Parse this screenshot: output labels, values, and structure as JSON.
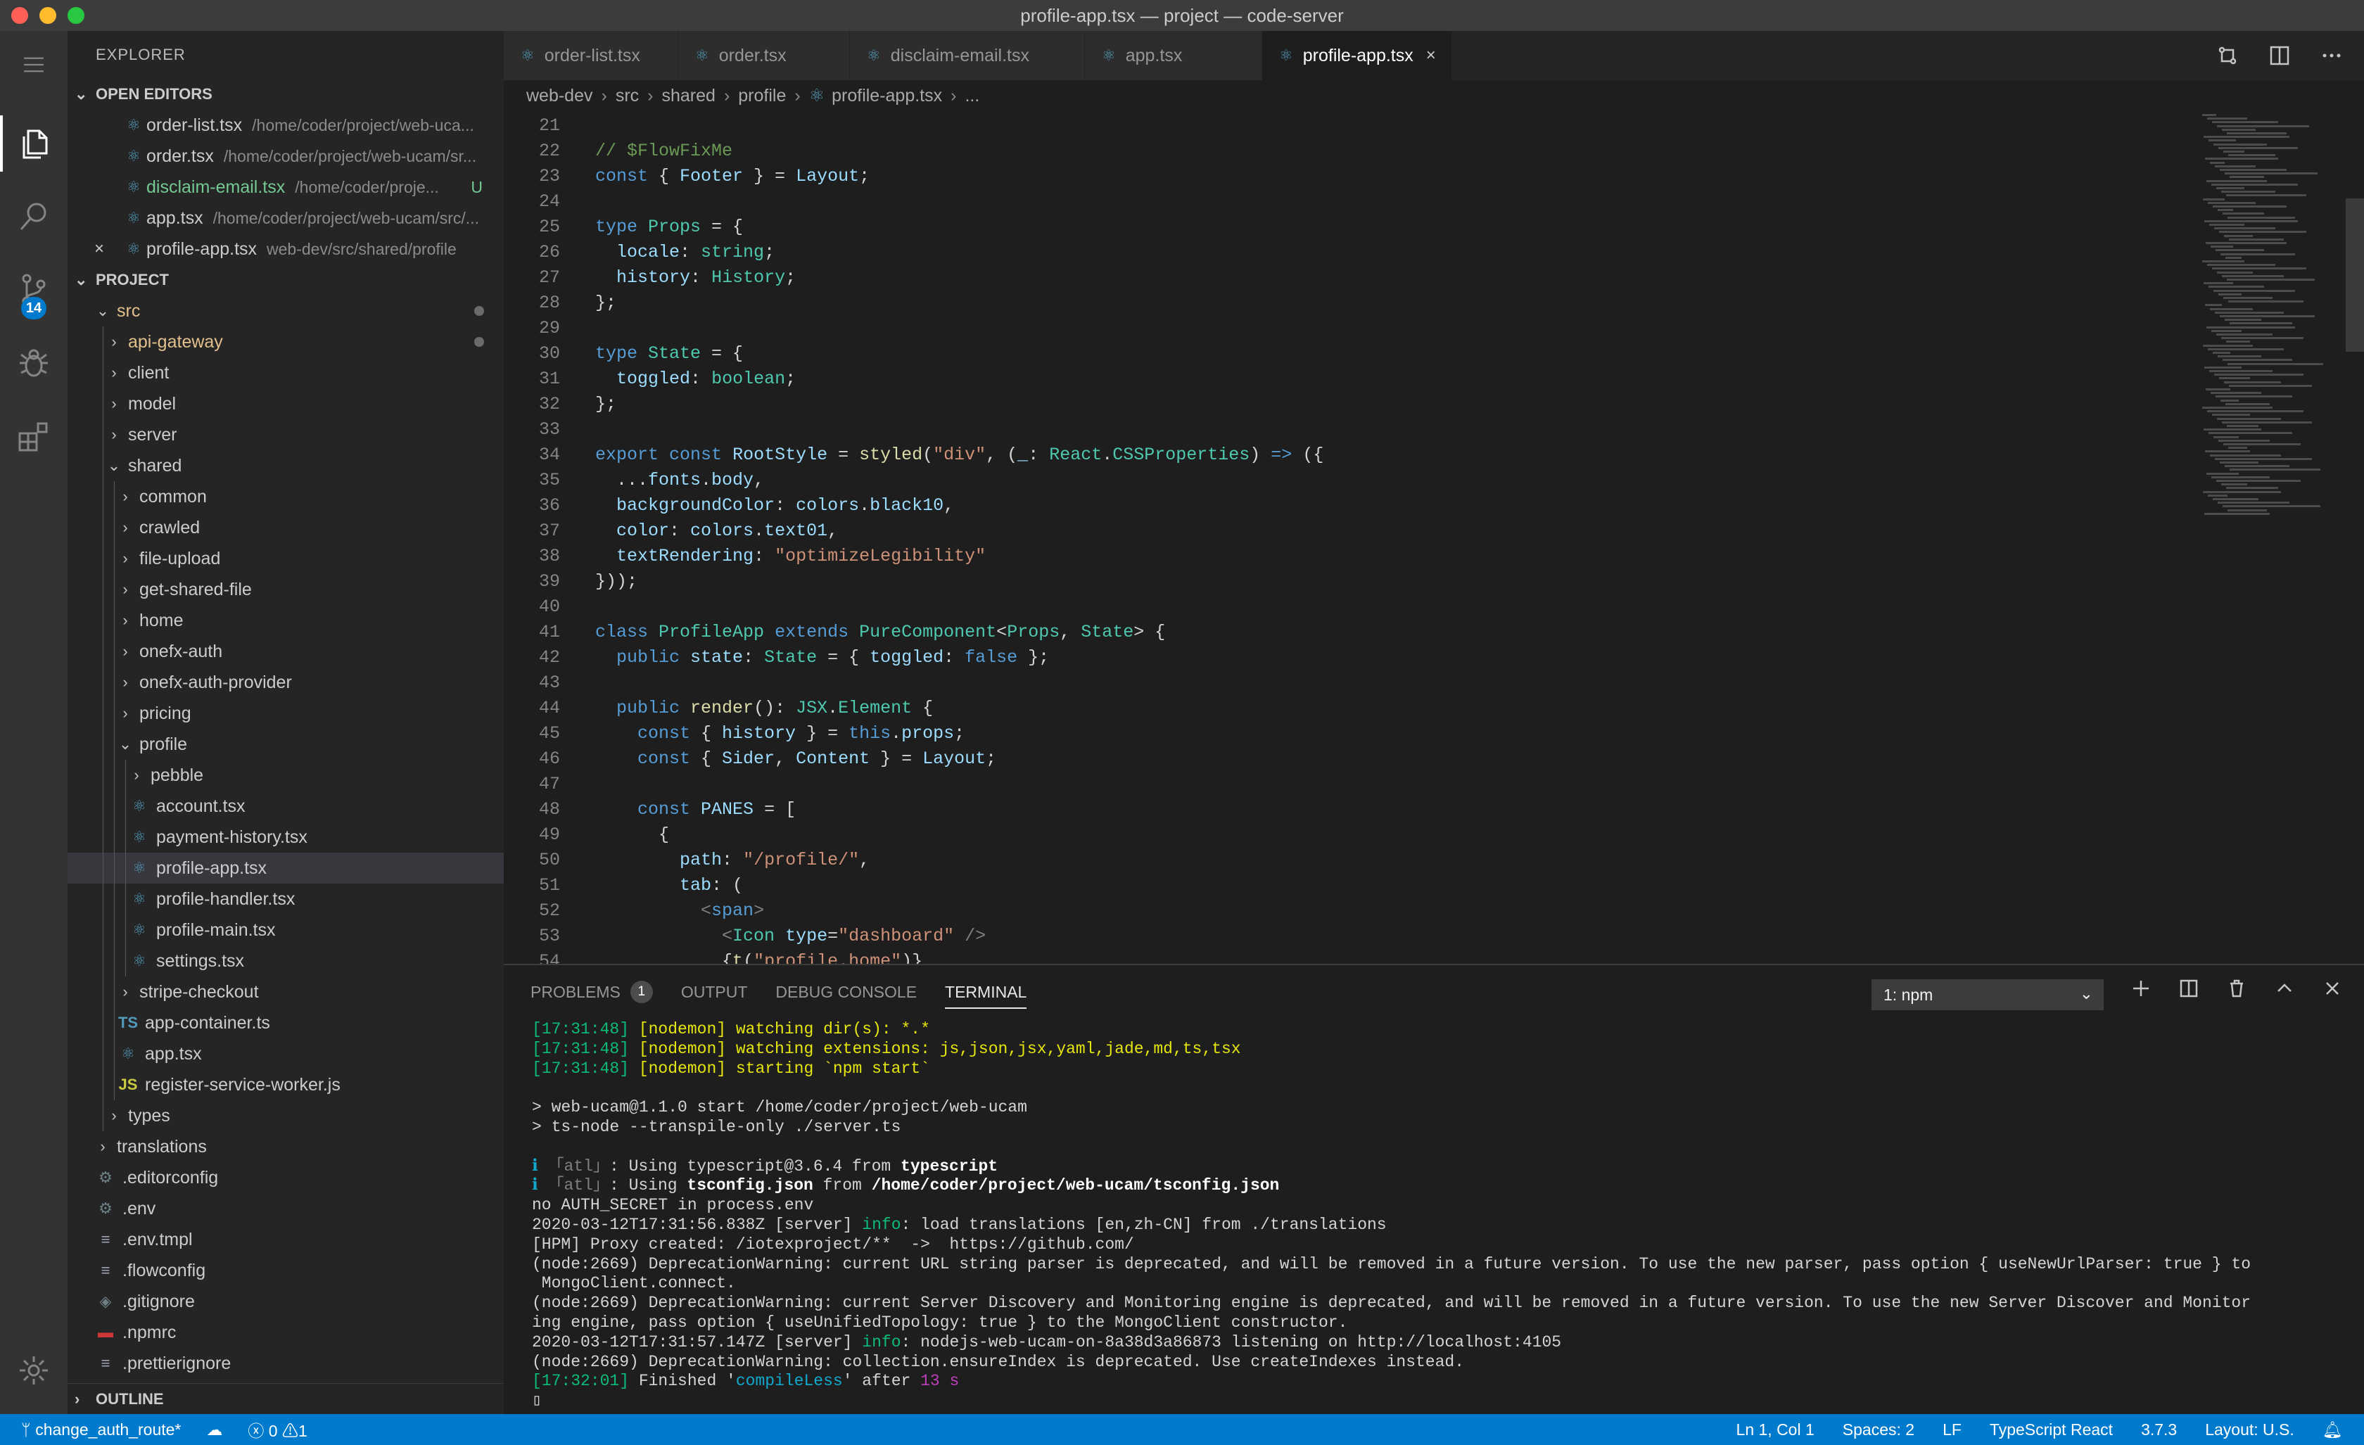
{
  "window": {
    "title": "profile-app.tsx — project — code-server"
  },
  "activity": {
    "scm_badge": "14"
  },
  "explorer": {
    "title": "EXPLORER",
    "open_editors_label": "OPEN EDITORS",
    "open_editors": [
      {
        "name": "order-list.tsx",
        "path": "/home/coder/project/web-uca...",
        "git": ""
      },
      {
        "name": "order.tsx",
        "path": "/home/coder/project/web-ucam/sr...",
        "git": ""
      },
      {
        "name": "disclaim-email.tsx",
        "path": "/home/coder/proje...",
        "git": "U"
      },
      {
        "name": "app.tsx",
        "path": "/home/coder/project/web-ucam/src/...",
        "git": ""
      },
      {
        "name": "profile-app.tsx",
        "path": "web-dev/src/shared/profile",
        "git": ""
      }
    ],
    "project_label": "PROJECT",
    "tree": [
      {
        "label": "src",
        "depth": 1,
        "kind": "folder-open",
        "icon": "",
        "dot": true
      },
      {
        "label": "api-gateway",
        "depth": 2,
        "kind": "folder",
        "icon": "",
        "dot": true
      },
      {
        "label": "client",
        "depth": 2,
        "kind": "folder",
        "icon": ""
      },
      {
        "label": "model",
        "depth": 2,
        "kind": "folder",
        "icon": ""
      },
      {
        "label": "server",
        "depth": 2,
        "kind": "folder",
        "icon": ""
      },
      {
        "label": "shared",
        "depth": 2,
        "kind": "folder-open",
        "icon": ""
      },
      {
        "label": "common",
        "depth": 3,
        "kind": "folder",
        "icon": ""
      },
      {
        "label": "crawled",
        "depth": 3,
        "kind": "folder",
        "icon": ""
      },
      {
        "label": "file-upload",
        "depth": 3,
        "kind": "folder",
        "icon": ""
      },
      {
        "label": "get-shared-file",
        "depth": 3,
        "kind": "folder",
        "icon": ""
      },
      {
        "label": "home",
        "depth": 3,
        "kind": "folder",
        "icon": ""
      },
      {
        "label": "onefx-auth",
        "depth": 3,
        "kind": "folder",
        "icon": ""
      },
      {
        "label": "onefx-auth-provider",
        "depth": 3,
        "kind": "folder",
        "icon": ""
      },
      {
        "label": "pricing",
        "depth": 3,
        "kind": "folder",
        "icon": ""
      },
      {
        "label": "profile",
        "depth": 3,
        "kind": "folder-open",
        "icon": ""
      },
      {
        "label": "pebble",
        "depth": 4,
        "kind": "folder",
        "icon": ""
      },
      {
        "label": "account.tsx",
        "depth": 4,
        "kind": "file",
        "icon": "react"
      },
      {
        "label": "payment-history.tsx",
        "depth": 4,
        "kind": "file",
        "icon": "react"
      },
      {
        "label": "profile-app.tsx",
        "depth": 4,
        "kind": "file",
        "icon": "react",
        "selected": true
      },
      {
        "label": "profile-handler.tsx",
        "depth": 4,
        "kind": "file",
        "icon": "react"
      },
      {
        "label": "profile-main.tsx",
        "depth": 4,
        "kind": "file",
        "icon": "react"
      },
      {
        "label": "settings.tsx",
        "depth": 4,
        "kind": "file",
        "icon": "react"
      },
      {
        "label": "stripe-checkout",
        "depth": 3,
        "kind": "folder",
        "icon": ""
      },
      {
        "label": "app-container.ts",
        "depth": 3,
        "kind": "file",
        "icon": "ts"
      },
      {
        "label": "app.tsx",
        "depth": 3,
        "kind": "file",
        "icon": "react"
      },
      {
        "label": "register-service-worker.js",
        "depth": 3,
        "kind": "file",
        "icon": "js"
      },
      {
        "label": "types",
        "depth": 2,
        "kind": "folder",
        "icon": ""
      },
      {
        "label": "translations",
        "depth": 1,
        "kind": "folder",
        "icon": ""
      },
      {
        "label": ".editorconfig",
        "depth": 1,
        "kind": "file",
        "icon": "gear"
      },
      {
        "label": ".env",
        "depth": 1,
        "kind": "file",
        "icon": "gear"
      },
      {
        "label": ".env.tmpl",
        "depth": 1,
        "kind": "file",
        "icon": "lines"
      },
      {
        "label": ".flowconfig",
        "depth": 1,
        "kind": "file",
        "icon": "lines"
      },
      {
        "label": ".gitignore",
        "depth": 1,
        "kind": "file",
        "icon": "git"
      },
      {
        "label": ".npmrc",
        "depth": 1,
        "kind": "file",
        "icon": "npm"
      },
      {
        "label": ".prettierignore",
        "depth": 1,
        "kind": "file",
        "icon": "lines"
      }
    ],
    "outline_label": "OUTLINE"
  },
  "tabs": [
    {
      "label": "order-list.tsx",
      "active": false
    },
    {
      "label": "order.tsx",
      "active": false
    },
    {
      "label": "disclaim-email.tsx",
      "active": false
    },
    {
      "label": "app.tsx",
      "active": false
    },
    {
      "label": "profile-app.tsx",
      "active": true
    }
  ],
  "breadcrumb": [
    "web-dev",
    "src",
    "shared",
    "profile",
    "profile-app.tsx",
    "..."
  ],
  "code": [
    {
      "n": "21",
      "tokens": []
    },
    {
      "n": "22",
      "tokens": [
        [
          "c",
          "// $FlowFixMe"
        ]
      ]
    },
    {
      "n": "23",
      "tokens": [
        [
          "k",
          "const"
        ],
        [
          "p",
          " { "
        ],
        [
          "v",
          "Footer"
        ],
        [
          "p",
          " } = "
        ],
        [
          "v",
          "Layout"
        ],
        [
          "p",
          ";"
        ]
      ]
    },
    {
      "n": "24",
      "tokens": []
    },
    {
      "n": "25",
      "tokens": [
        [
          "k",
          "type"
        ],
        [
          "p",
          " "
        ],
        [
          "t",
          "Props"
        ],
        [
          "p",
          " = {"
        ]
      ]
    },
    {
      "n": "26",
      "tokens": [
        [
          "p",
          "  "
        ],
        [
          "v",
          "locale"
        ],
        [
          "p",
          ": "
        ],
        [
          "t",
          "string"
        ],
        [
          "p",
          ";"
        ]
      ]
    },
    {
      "n": "27",
      "tokens": [
        [
          "p",
          "  "
        ],
        [
          "v",
          "history"
        ],
        [
          "p",
          ": "
        ],
        [
          "t",
          "History"
        ],
        [
          "p",
          ";"
        ]
      ]
    },
    {
      "n": "28",
      "tokens": [
        [
          "p",
          "};"
        ]
      ]
    },
    {
      "n": "29",
      "tokens": []
    },
    {
      "n": "30",
      "tokens": [
        [
          "k",
          "type"
        ],
        [
          "p",
          " "
        ],
        [
          "t",
          "State"
        ],
        [
          "p",
          " = {"
        ]
      ]
    },
    {
      "n": "31",
      "tokens": [
        [
          "p",
          "  "
        ],
        [
          "v",
          "toggled"
        ],
        [
          "p",
          ": "
        ],
        [
          "t",
          "boolean"
        ],
        [
          "p",
          ";"
        ]
      ]
    },
    {
      "n": "32",
      "tokens": [
        [
          "p",
          "};"
        ]
      ]
    },
    {
      "n": "33",
      "tokens": []
    },
    {
      "n": "34",
      "tokens": [
        [
          "k",
          "export"
        ],
        [
          "p",
          " "
        ],
        [
          "k",
          "const"
        ],
        [
          "p",
          " "
        ],
        [
          "v",
          "RootStyle"
        ],
        [
          "p",
          " = "
        ],
        [
          "f",
          "styled"
        ],
        [
          "p",
          "("
        ],
        [
          "s",
          "\"div\""
        ],
        [
          "p",
          ", ("
        ],
        [
          "v",
          "_"
        ],
        [
          "p",
          ": "
        ],
        [
          "t",
          "React"
        ],
        [
          "p",
          "."
        ],
        [
          "t",
          "CSSProperties"
        ],
        [
          "p",
          ") "
        ],
        [
          "k",
          "=>"
        ],
        [
          "p",
          " ({"
        ]
      ]
    },
    {
      "n": "35",
      "tokens": [
        [
          "p",
          "  ..."
        ],
        [
          "v",
          "fonts"
        ],
        [
          "p",
          "."
        ],
        [
          "v",
          "body"
        ],
        [
          "p",
          ","
        ]
      ]
    },
    {
      "n": "36",
      "tokens": [
        [
          "p",
          "  "
        ],
        [
          "v",
          "backgroundColor"
        ],
        [
          "p",
          ": "
        ],
        [
          "v",
          "colors"
        ],
        [
          "p",
          "."
        ],
        [
          "v",
          "black10"
        ],
        [
          "p",
          ","
        ]
      ]
    },
    {
      "n": "37",
      "tokens": [
        [
          "p",
          "  "
        ],
        [
          "v",
          "color"
        ],
        [
          "p",
          ": "
        ],
        [
          "v",
          "colors"
        ],
        [
          "p",
          "."
        ],
        [
          "v",
          "text01"
        ],
        [
          "p",
          ","
        ]
      ]
    },
    {
      "n": "38",
      "tokens": [
        [
          "p",
          "  "
        ],
        [
          "v",
          "textRendering"
        ],
        [
          "p",
          ": "
        ],
        [
          "s",
          "\"optimizeLegibility\""
        ]
      ]
    },
    {
      "n": "39",
      "tokens": [
        [
          "p",
          "}));"
        ]
      ]
    },
    {
      "n": "40",
      "tokens": []
    },
    {
      "n": "41",
      "tokens": [
        [
          "k",
          "class"
        ],
        [
          "p",
          " "
        ],
        [
          "t",
          "ProfileApp"
        ],
        [
          "p",
          " "
        ],
        [
          "k",
          "extends"
        ],
        [
          "p",
          " "
        ],
        [
          "t",
          "PureComponent"
        ],
        [
          "p",
          "<"
        ],
        [
          "t",
          "Props"
        ],
        [
          "p",
          ", "
        ],
        [
          "t",
          "State"
        ],
        [
          "p",
          "> {"
        ]
      ]
    },
    {
      "n": "42",
      "tokens": [
        [
          "p",
          "  "
        ],
        [
          "k",
          "public"
        ],
        [
          "p",
          " "
        ],
        [
          "v",
          "state"
        ],
        [
          "p",
          ": "
        ],
        [
          "t",
          "State"
        ],
        [
          "p",
          " = { "
        ],
        [
          "v",
          "toggled"
        ],
        [
          "p",
          ": "
        ],
        [
          "k",
          "false"
        ],
        [
          "p",
          " };"
        ]
      ]
    },
    {
      "n": "43",
      "tokens": []
    },
    {
      "n": "44",
      "tokens": [
        [
          "p",
          "  "
        ],
        [
          "k",
          "public"
        ],
        [
          "p",
          " "
        ],
        [
          "f",
          "render"
        ],
        [
          "p",
          "(): "
        ],
        [
          "t",
          "JSX"
        ],
        [
          "p",
          "."
        ],
        [
          "t",
          "Element"
        ],
        [
          "p",
          " {"
        ]
      ]
    },
    {
      "n": "45",
      "tokens": [
        [
          "p",
          "    "
        ],
        [
          "k",
          "const"
        ],
        [
          "p",
          " { "
        ],
        [
          "v",
          "history"
        ],
        [
          "p",
          " } = "
        ],
        [
          "k",
          "this"
        ],
        [
          "p",
          "."
        ],
        [
          "v",
          "props"
        ],
        [
          "p",
          ";"
        ]
      ]
    },
    {
      "n": "46",
      "tokens": [
        [
          "p",
          "    "
        ],
        [
          "k",
          "const"
        ],
        [
          "p",
          " { "
        ],
        [
          "v",
          "Sider"
        ],
        [
          "p",
          ", "
        ],
        [
          "v",
          "Content"
        ],
        [
          "p",
          " } = "
        ],
        [
          "v",
          "Layout"
        ],
        [
          "p",
          ";"
        ]
      ]
    },
    {
      "n": "47",
      "tokens": []
    },
    {
      "n": "48",
      "tokens": [
        [
          "p",
          "    "
        ],
        [
          "k",
          "const"
        ],
        [
          "p",
          " "
        ],
        [
          "v",
          "PANES"
        ],
        [
          "p",
          " = ["
        ]
      ]
    },
    {
      "n": "49",
      "tokens": [
        [
          "p",
          "      {"
        ]
      ]
    },
    {
      "n": "50",
      "tokens": [
        [
          "p",
          "        "
        ],
        [
          "v",
          "path"
        ],
        [
          "p",
          ": "
        ],
        [
          "s",
          "\"/profile/\""
        ],
        [
          "p",
          ","
        ]
      ]
    },
    {
      "n": "51",
      "tokens": [
        [
          "p",
          "        "
        ],
        [
          "v",
          "tab"
        ],
        [
          "p",
          ": ("
        ]
      ]
    },
    {
      "n": "52",
      "tokens": [
        [
          "p",
          "          "
        ],
        [
          "tag",
          "<"
        ],
        [
          "tg",
          "span"
        ],
        [
          "tag",
          ">"
        ]
      ]
    },
    {
      "n": "53",
      "tokens": [
        [
          "p",
          "            "
        ],
        [
          "tag",
          "<"
        ],
        [
          "t",
          "Icon"
        ],
        [
          "p",
          " "
        ],
        [
          "v",
          "type"
        ],
        [
          "p",
          "="
        ],
        [
          "s",
          "\"dashboard\""
        ],
        [
          "p",
          " "
        ],
        [
          "tag",
          "/>"
        ]
      ]
    },
    {
      "n": "54",
      "tokens": [
        [
          "p",
          "            {"
        ],
        [
          "f",
          "t"
        ],
        [
          "p",
          "("
        ],
        [
          "s",
          "\"profile.home\""
        ],
        [
          "p",
          ")}"
        ]
      ]
    }
  ],
  "panel": {
    "tabs": [
      {
        "label": "PROBLEMS",
        "badge": "1",
        "active": false
      },
      {
        "label": "OUTPUT",
        "active": false
      },
      {
        "label": "DEBUG CONSOLE",
        "active": false
      },
      {
        "label": "TERMINAL",
        "active": true
      }
    ],
    "terminal_select": "1: npm"
  },
  "terminal": [
    [
      [
        "g",
        "[17:31:48] "
      ],
      [
        "y",
        "[nodemon] watching dir(s): *.*"
      ]
    ],
    [
      [
        "g",
        "[17:31:48] "
      ],
      [
        "y",
        "[nodemon] watching extensions: js,json,jsx,yaml,jade,md,ts,tsx"
      ]
    ],
    [
      [
        "g",
        "[17:31:48] "
      ],
      [
        "y",
        "[nodemon] starting `npm start`"
      ]
    ],
    [],
    [
      [
        "p",
        "> web-ucam@1.1.0 start /home/coder/project/web-ucam"
      ]
    ],
    [
      [
        "p",
        "> ts-node --transpile-only ./server.ts"
      ]
    ],
    [],
    [
      [
        "cy",
        "ℹ "
      ],
      [
        "dim",
        "「atl」"
      ],
      [
        "p",
        ": Using typescript@3.6.4 from "
      ],
      [
        "b",
        "typescript"
      ]
    ],
    [
      [
        "cy",
        "ℹ "
      ],
      [
        "dim",
        "「atl」"
      ],
      [
        "p",
        ": Using "
      ],
      [
        "b",
        "tsconfig.json"
      ],
      [
        "p",
        " from "
      ],
      [
        "b",
        "/home/coder/project/web-ucam/tsconfig.json"
      ]
    ],
    [
      [
        "p",
        "no AUTH_SECRET in process.env"
      ]
    ],
    [
      [
        "p",
        "2020-03-12T17:31:56.838Z [server] "
      ],
      [
        "g",
        "info"
      ],
      [
        "p",
        ": load translations [en,zh-CN] from ./translations"
      ]
    ],
    [
      [
        "p",
        "[HPM] Proxy created: /iotexproject/**  ->  https://github.com/"
      ]
    ],
    [
      [
        "p",
        "(node:2669) DeprecationWarning: current URL string parser is deprecated, and will be removed in a future version. To use the new parser, pass option { useNewUrlParser: true } to"
      ]
    ],
    [
      [
        "p",
        " MongoClient.connect."
      ]
    ],
    [
      [
        "p",
        "(node:2669) DeprecationWarning: current Server Discovery and Monitoring engine is deprecated, and will be removed in a future version. To use the new Server Discover and Monitor"
      ]
    ],
    [
      [
        "p",
        "ing engine, pass option { useUnifiedTopology: true } to the MongoClient constructor."
      ]
    ],
    [
      [
        "p",
        "2020-03-12T17:31:57.147Z [server] "
      ],
      [
        "g",
        "info"
      ],
      [
        "p",
        ": nodejs-web-ucam-on-8a38d3a86873 listening on http://localhost:4105"
      ]
    ],
    [
      [
        "p",
        "(node:2669) DeprecationWarning: collection.ensureIndex is deprecated. Use createIndexes instead."
      ]
    ],
    [
      [
        "g",
        "[17:32:01] "
      ],
      [
        "p",
        "Finished '"
      ],
      [
        "cy",
        "compileLess"
      ],
      [
        "p",
        "' after "
      ],
      [
        "m",
        "13 s"
      ]
    ],
    [
      [
        "p",
        "▯"
      ]
    ]
  ],
  "statusbar": {
    "branch": "change_auth_route*",
    "errors": "0",
    "warnings": "1",
    "position": "Ln 1, Col 1",
    "spaces": "Spaces: 2",
    "eol": "LF",
    "language": "TypeScript React",
    "version": "3.7.3",
    "layout": "Layout: U.S."
  }
}
